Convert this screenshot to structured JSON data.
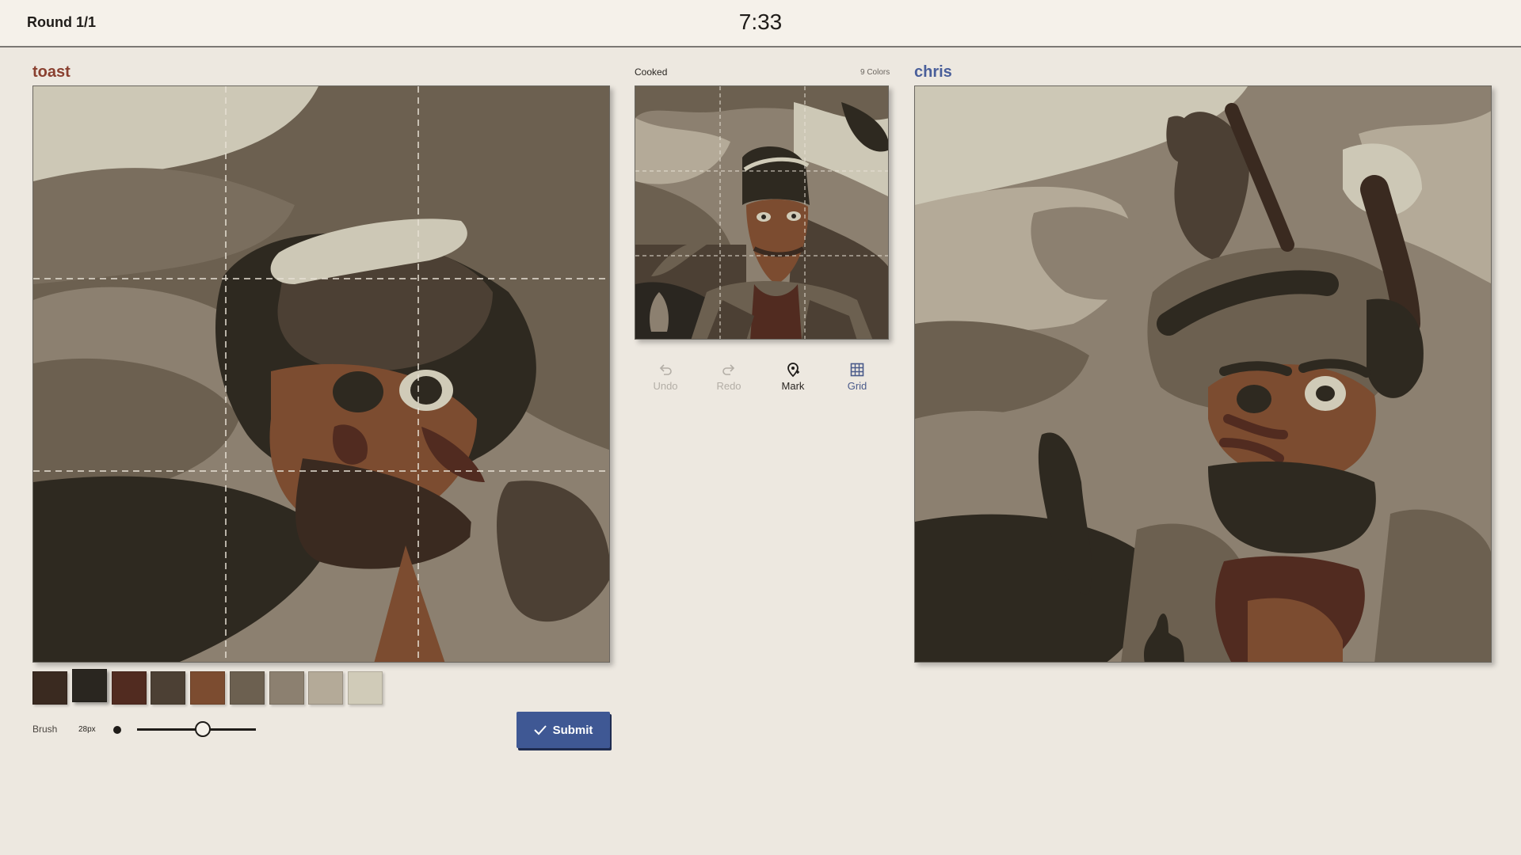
{
  "header": {
    "round": "Round 1/1",
    "timer": "7:33"
  },
  "players": {
    "left": {
      "name": "toast",
      "color": "#8a4030"
    },
    "right": {
      "name": "chris",
      "color": "#4a5f9a"
    }
  },
  "reference": {
    "title": "Cooked",
    "color_count": "9 Colors"
  },
  "tools": [
    {
      "label": "Undo",
      "icon": "undo-icon",
      "enabled": false
    },
    {
      "label": "Redo",
      "icon": "redo-icon",
      "enabled": false
    },
    {
      "label": "Mark",
      "icon": "mark-pin-icon",
      "enabled": true
    },
    {
      "label": "Grid",
      "icon": "grid-icon",
      "enabled": true
    }
  ],
  "palette": [
    "#3a2a20",
    "#2a2620",
    "#512b20",
    "#4c4034",
    "#7c4c30",
    "#6c6050",
    "#8c8070",
    "#b4aa98",
    "#d0cbb8"
  ],
  "selected_color_index": 1,
  "brush": {
    "label": "Brush",
    "size": "28px",
    "level": 0.55
  },
  "submit": {
    "label": "Submit",
    "icon": "check-icon"
  }
}
